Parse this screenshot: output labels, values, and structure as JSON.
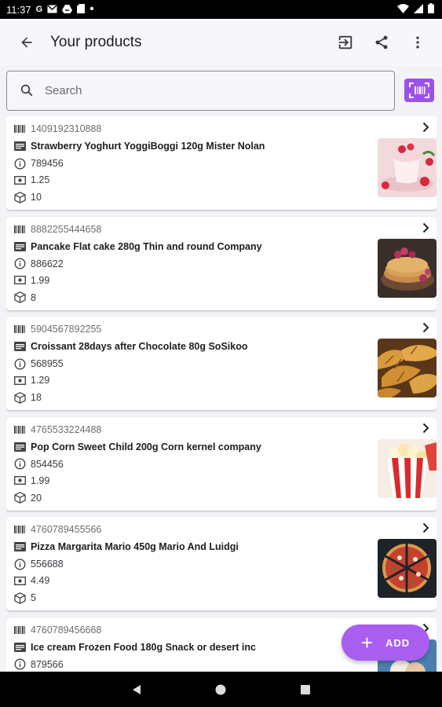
{
  "status_bar": {
    "time": "11:37",
    "icons_left": [
      "G",
      "mail-icon",
      "drive-icon",
      "sd-icon",
      "dot"
    ],
    "icons_right": [
      "wifi-icon",
      "signal-icon",
      "battery-icon"
    ]
  },
  "app_bar": {
    "title": "Your products",
    "actions": [
      "import-icon",
      "share-icon",
      "more-icon"
    ]
  },
  "search": {
    "placeholder": "Search"
  },
  "products": [
    {
      "barcode": "1409192310888",
      "name": "Strawberry Yoghurt YoggiBoggi 120g Mister Nolan",
      "code": "789456",
      "price": "1.25",
      "quantity": "10",
      "image": "yoghurt"
    },
    {
      "barcode": "8882255444658",
      "name": "Pancake Flat cake 280g Thin and round Company",
      "code": "886622",
      "price": "1.99",
      "quantity": "8",
      "image": "pancake"
    },
    {
      "barcode": "5904567892255",
      "name": "Croissant 28days after Chocolate 80g SoSikoo",
      "code": "568955",
      "price": "1.29",
      "quantity": "18",
      "image": "croissant"
    },
    {
      "barcode": "4765533224488",
      "name": "Pop Corn Sweet Child 200g Corn kernel company",
      "code": "854456",
      "price": "1.99",
      "quantity": "20",
      "image": "popcorn"
    },
    {
      "barcode": "4760789455566",
      "name": "Pizza Margarita Mario 450g Mario And Luidgi",
      "code": "556688",
      "price": "4.49",
      "quantity": "5",
      "image": "pizza"
    },
    {
      "barcode": "4760789456668",
      "name": "Ice cream Frozen Food 180g Snack or desert inc",
      "code": "879566",
      "price": "",
      "quantity": "",
      "image": "icecream"
    }
  ],
  "fab": {
    "label": "ADD"
  },
  "colors": {
    "accent": "#9b52e8",
    "fab": "#a95ef0",
    "background": "#f3f2f6"
  }
}
